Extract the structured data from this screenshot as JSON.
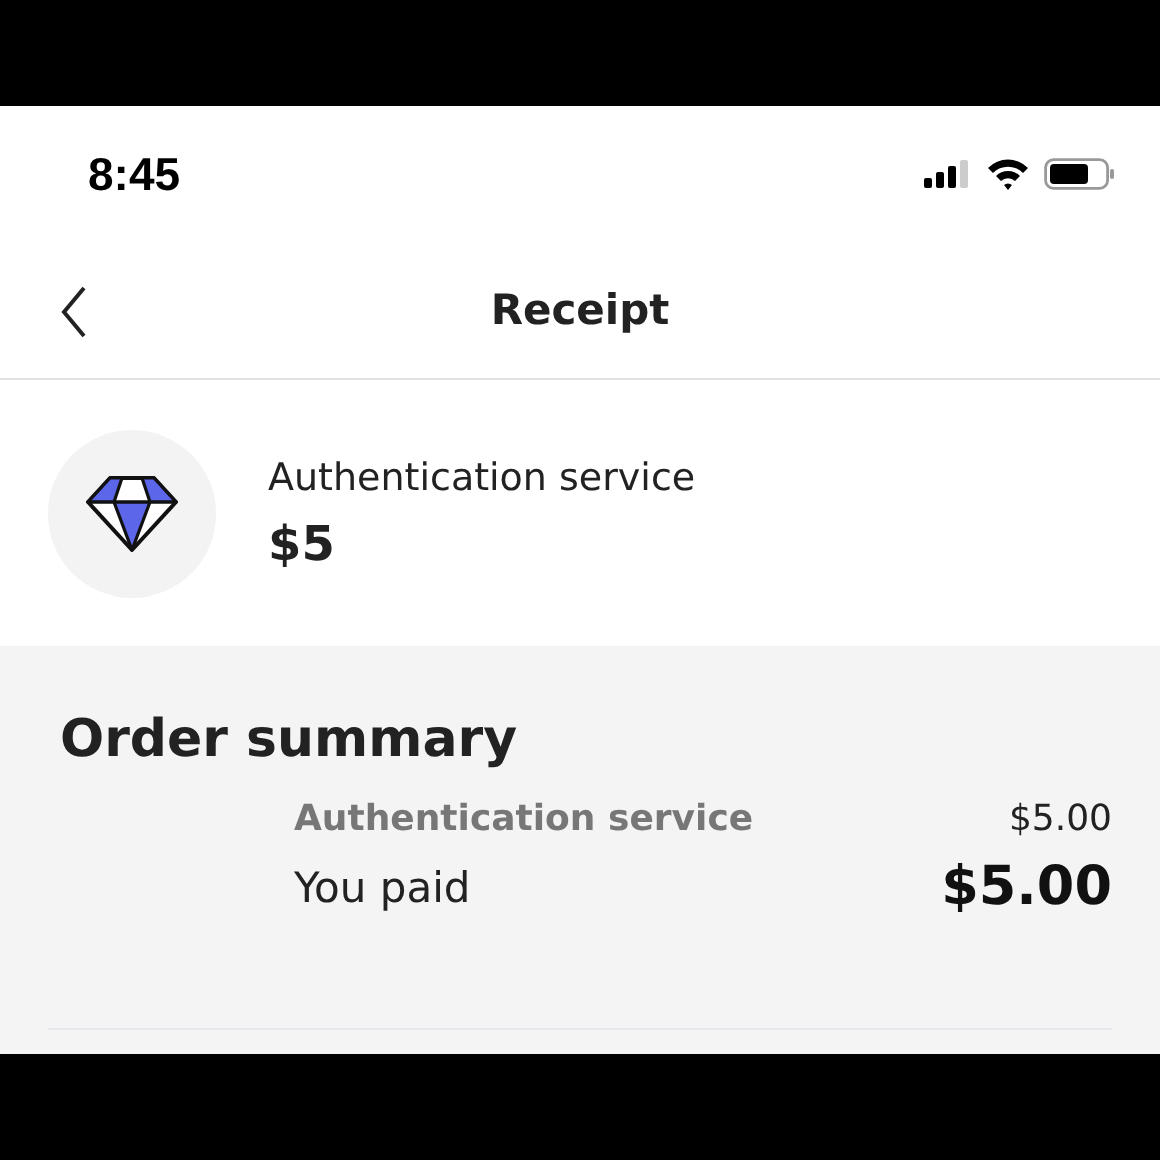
{
  "status_bar": {
    "time": "8:45"
  },
  "header": {
    "title": "Receipt"
  },
  "product": {
    "name": "Authentication service",
    "price": "$5"
  },
  "order_summary": {
    "title": "Order summary",
    "lines": [
      {
        "kind": "item",
        "label": "Authentication service",
        "amount": "$5.00"
      },
      {
        "kind": "total",
        "label": "You paid",
        "amount": "$5.00"
      }
    ]
  }
}
